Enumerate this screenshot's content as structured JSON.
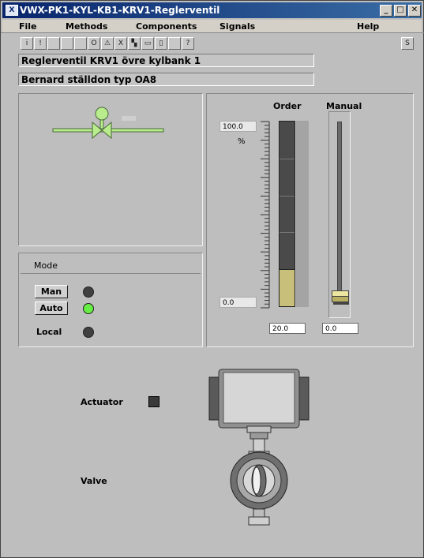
{
  "window": {
    "title": "VWX-PK1-KYL-KB1-KRV1-Reglerventil",
    "app_icon_text": "X"
  },
  "menu": [
    "File",
    "Methods",
    "Components",
    "Signals",
    "Help"
  ],
  "toolbar": {
    "buttons": [
      "i",
      "!",
      "",
      "",
      "",
      "O",
      "⚠",
      "X",
      "▚",
      "▭",
      "▯",
      "",
      "?"
    ],
    "right_button": "S"
  },
  "description": {
    "line1": "Reglerventil KRV1 övre kylbank 1",
    "line2": "Bernard ställdon typ OA8"
  },
  "mode": {
    "title": "Mode",
    "man_label": "Man",
    "auto_label": "Auto",
    "local_label": "Local",
    "man_active": false,
    "auto_active": true,
    "local_active": false
  },
  "order": {
    "label": "Order",
    "max": "100.0",
    "min": "0.0",
    "unit": "%",
    "value": "20.0",
    "fraction": 0.2
  },
  "manual": {
    "label": "Manual",
    "value": "0.0",
    "fraction": 0.0
  },
  "equipment": {
    "actuator_label": "Actuator",
    "valve_label": "Valve"
  },
  "colors": {
    "led_off": "#404040",
    "led_on": "#66ee44",
    "valve_green": "#b8ec8c",
    "order_fill": "#c8c07a"
  }
}
